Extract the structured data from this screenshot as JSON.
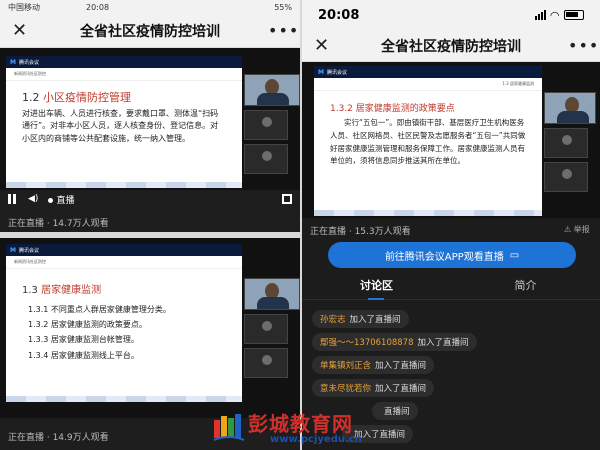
{
  "left": {
    "status": {
      "carrier": "中国移动",
      "time": "20:08",
      "battery": "55%"
    },
    "nav": {
      "title": "全省社区疫情防控培训",
      "close": "✕",
      "more": "•••"
    },
    "video1": {
      "app_name": "腾讯会议",
      "header_text": "新闻资讯社区防控",
      "title_num": "1.2 ",
      "title": "小区疫情防控管理",
      "body": "对进出车辆、人员进行核查，要求戴口罩、测体温“扫码通行”。对非本小区人员，逐人核查身份、登记信息。对小区内的商铺等公共配套设施，统一纳入管理。",
      "live_label": "直播",
      "status": "正在直播 · 14.7万人观看"
    },
    "video2": {
      "app_name": "腾讯会议",
      "header_text": "新闻资讯社区防控",
      "title_num": "1.3 ",
      "title": "居家健康监测",
      "items": [
        "1.3.1 不同重点人群居家健康管理分类。",
        "1.3.2 居家健康监测的政策要点。",
        "1.3.3 居家健康监测台帐管理。",
        "1.3.4 居家健康监测线上平台。"
      ],
      "status": "正在直播 · 14.9万人观看"
    }
  },
  "right": {
    "status": {
      "time": "20:08"
    },
    "nav": {
      "title": "全省社区疫情防控培训",
      "close": "✕",
      "more": "•••"
    },
    "video": {
      "app_name": "腾讯会议",
      "sub_right": "1.3 居家健康监测",
      "title": "1.3.2 居家健康监测的政策要点",
      "body": "实行“五包一”。即由镇街干部、基层医疗卫生机构医务人员、社区网格员、社区民警及志愿服务者“五包一”共同做好居家健康监测管理和服务保障工作。居家健康监测人员有单位的，须将信息同步推送其所在单位。"
    },
    "status_line": "正在直播 · 15.3万人观看",
    "report": "举报",
    "watch_button": "前往腾讯会议APP观看直播",
    "tabs": [
      "讨论区",
      "简介"
    ],
    "chat": [
      {
        "user": "孙宏志",
        "text": "加入了直播间"
      },
      {
        "user": "鄢强～～13706108878",
        "text": "加入了直播间"
      },
      {
        "user": "单集镇刘正含",
        "text": "加入了直播间"
      },
      {
        "user": "意未尽犹若你",
        "text": "加入了直播间"
      },
      {
        "user": "",
        "text": "直播间"
      },
      {
        "user": "",
        "text": "加入了直播间"
      }
    ]
  },
  "watermark": {
    "text": "彭城教育网",
    "url": "www.pcjyedu.cn"
  },
  "colors": {
    "accent_blue": "#1e73d6",
    "slide_red": "#c0392b",
    "chat_user": "#e7a13c",
    "watermark_red": "#d0302a"
  }
}
